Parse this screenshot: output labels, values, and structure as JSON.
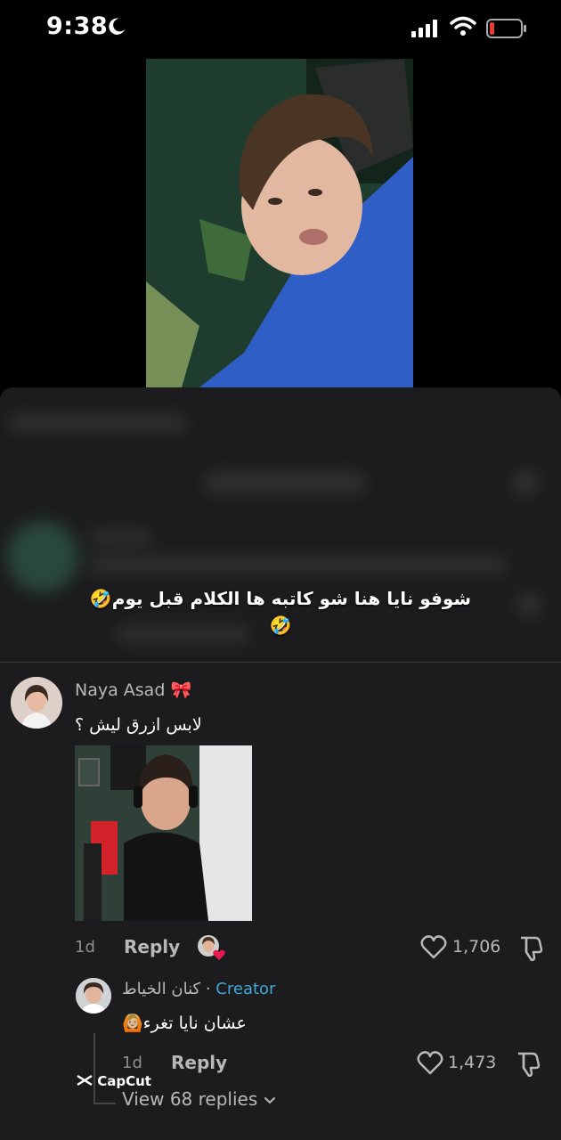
{
  "status_bar": {
    "time": "9:38"
  },
  "overlay": {
    "caption": "شوفو نايا هنا شو كاتبه ها الكلام قبل يوم🤣🤣"
  },
  "comment": {
    "author": "Naya Asad",
    "author_emoji": "🎀",
    "text": "لابس ازرق ليش ؟",
    "age": "1d",
    "reply_label": "Reply",
    "likes": "1,706"
  },
  "reply_comment": {
    "author": "كنان الخياط",
    "separator": "·",
    "badge": "Creator",
    "text": "عشان نايا تغرء🙆🏼",
    "age": "1d",
    "reply_label": "Reply",
    "likes": "1,473"
  },
  "view_replies": "View 68 replies",
  "watermark": "CapCut",
  "icons": [
    "moon-icon",
    "signal-icon",
    "wifi-icon",
    "battery-icon",
    "heart-icon",
    "dislike-icon",
    "chevron-down-icon",
    "capcut-logo-icon"
  ],
  "colors": {
    "background": "#000000",
    "sheet": "#1c1c1e",
    "creator": "#3fa7d6",
    "liked_heart": "#e8194f"
  }
}
